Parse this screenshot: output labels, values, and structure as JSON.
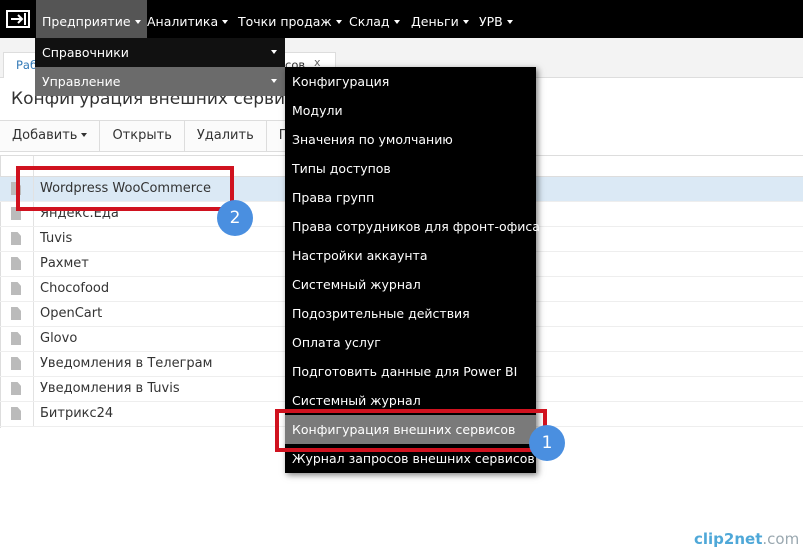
{
  "nav": {
    "items": [
      "Предприятие",
      "Аналитика",
      "Точки продаж",
      "Склад",
      "Деньги",
      "УРВ"
    ]
  },
  "tabs": {
    "first_tab_label": "Раб",
    "second_tab_partial": "сов",
    "close": "x"
  },
  "page": {
    "title": "Конфигурация внешних сервисов"
  },
  "toolbar": {
    "add": "Добавить",
    "open": "Открыть",
    "delete": "Удалить",
    "print": "Печа"
  },
  "table": {
    "rows": [
      "Wordpress WooCommerce",
      "Яндекс.Еда",
      "Tuvis",
      "Рахмет",
      "Chocofood",
      "OpenCart",
      "Glovo",
      "Уведомления в Телеграм",
      "Уведомления в Tuvis",
      "Битрикс24"
    ],
    "selected_row": 0
  },
  "menu_level1": {
    "items": [
      "Справочники",
      "Управление"
    ],
    "hovered": 1
  },
  "menu_level2": {
    "items": [
      "Конфигурация",
      "Модули",
      "Значения по умолчанию",
      "Типы доступов",
      "Права групп",
      "Права сотрудников для фронт-офиса",
      "Настройки аккаунта",
      "Системный журнал",
      "Подозрительные действия",
      "Оплата услуг",
      "Подготовить данные для Power BI",
      "Системный журнал",
      "Конфигурация внешних сервисов",
      "Журнал запросов внешних сервисов"
    ],
    "hovered": 12
  },
  "annotations": {
    "badge1": "1",
    "badge2": "2",
    "highlight_color": "#d0121f",
    "badge_color": "#4a8fe0"
  },
  "watermark": {
    "brand": "clip2net",
    "suffix": ".com"
  }
}
